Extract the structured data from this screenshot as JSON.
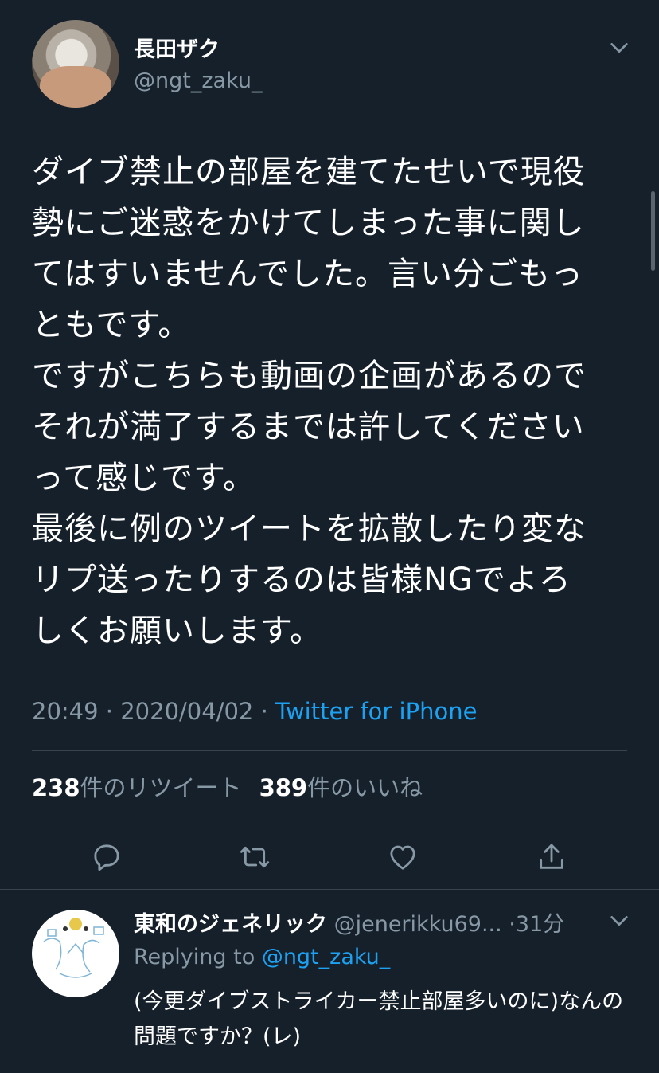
{
  "tweet": {
    "author_name": "長田ザク",
    "author_handle": "@ngt_zaku_",
    "text": "ダイブ禁止の部屋を建てたせいで現役\n勢にご迷惑をかけてしまった事に関し\nてはすいませんでした。言い分ごもっ\nともです。\nですがこちらも動画の企画があるので\nそれが満了するまでは許してください\nって感じです。\n最後に例のツイートを拡散したり変な\nリプ送ったりするのは皆様NGでよろ\nしくお願いします。",
    "time": "20:49",
    "separator": "·",
    "date": "2020/04/02",
    "source": "Twitter for iPhone",
    "retweet_count": "238",
    "retweet_label": "件のリツイート",
    "like_count": "389",
    "like_label": "件のいいね"
  },
  "icons": {
    "caret": "chevron-down-icon",
    "reply": "reply-icon",
    "retweet": "retweet-icon",
    "like": "heart-icon",
    "share": "share-icon"
  },
  "reply_tweet": {
    "author_name": "東和のジェネリック",
    "author_handle": "@jenerikku69...",
    "separator": "·",
    "time_ago": "31分",
    "replying_to_label": "Replying to",
    "replying_to_handle": "@ngt_zaku_",
    "text": "(今更ダイブストライカー禁止部屋多いのに)なんの問題ですか？(レ)"
  },
  "colors": {
    "background": "#15202b",
    "text_primary": "#ffffff",
    "text_secondary": "#8899a6",
    "accent": "#1da1f2",
    "divider": "#38444d"
  }
}
